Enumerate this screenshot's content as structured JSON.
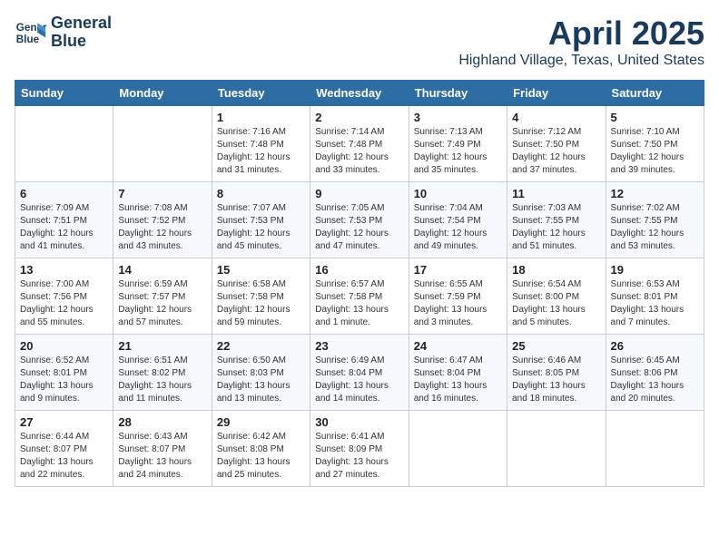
{
  "logo": {
    "line1": "General",
    "line2": "Blue"
  },
  "title": "April 2025",
  "location": "Highland Village, Texas, United States",
  "days_of_week": [
    "Sunday",
    "Monday",
    "Tuesday",
    "Wednesday",
    "Thursday",
    "Friday",
    "Saturday"
  ],
  "weeks": [
    [
      {
        "day": "",
        "info": ""
      },
      {
        "day": "",
        "info": ""
      },
      {
        "day": "1",
        "info": "Sunrise: 7:16 AM\nSunset: 7:48 PM\nDaylight: 12 hours and 31 minutes."
      },
      {
        "day": "2",
        "info": "Sunrise: 7:14 AM\nSunset: 7:48 PM\nDaylight: 12 hours and 33 minutes."
      },
      {
        "day": "3",
        "info": "Sunrise: 7:13 AM\nSunset: 7:49 PM\nDaylight: 12 hours and 35 minutes."
      },
      {
        "day": "4",
        "info": "Sunrise: 7:12 AM\nSunset: 7:50 PM\nDaylight: 12 hours and 37 minutes."
      },
      {
        "day": "5",
        "info": "Sunrise: 7:10 AM\nSunset: 7:50 PM\nDaylight: 12 hours and 39 minutes."
      }
    ],
    [
      {
        "day": "6",
        "info": "Sunrise: 7:09 AM\nSunset: 7:51 PM\nDaylight: 12 hours and 41 minutes."
      },
      {
        "day": "7",
        "info": "Sunrise: 7:08 AM\nSunset: 7:52 PM\nDaylight: 12 hours and 43 minutes."
      },
      {
        "day": "8",
        "info": "Sunrise: 7:07 AM\nSunset: 7:53 PM\nDaylight: 12 hours and 45 minutes."
      },
      {
        "day": "9",
        "info": "Sunrise: 7:05 AM\nSunset: 7:53 PM\nDaylight: 12 hours and 47 minutes."
      },
      {
        "day": "10",
        "info": "Sunrise: 7:04 AM\nSunset: 7:54 PM\nDaylight: 12 hours and 49 minutes."
      },
      {
        "day": "11",
        "info": "Sunrise: 7:03 AM\nSunset: 7:55 PM\nDaylight: 12 hours and 51 minutes."
      },
      {
        "day": "12",
        "info": "Sunrise: 7:02 AM\nSunset: 7:55 PM\nDaylight: 12 hours and 53 minutes."
      }
    ],
    [
      {
        "day": "13",
        "info": "Sunrise: 7:00 AM\nSunset: 7:56 PM\nDaylight: 12 hours and 55 minutes."
      },
      {
        "day": "14",
        "info": "Sunrise: 6:59 AM\nSunset: 7:57 PM\nDaylight: 12 hours and 57 minutes."
      },
      {
        "day": "15",
        "info": "Sunrise: 6:58 AM\nSunset: 7:58 PM\nDaylight: 12 hours and 59 minutes."
      },
      {
        "day": "16",
        "info": "Sunrise: 6:57 AM\nSunset: 7:58 PM\nDaylight: 13 hours and 1 minute."
      },
      {
        "day": "17",
        "info": "Sunrise: 6:55 AM\nSunset: 7:59 PM\nDaylight: 13 hours and 3 minutes."
      },
      {
        "day": "18",
        "info": "Sunrise: 6:54 AM\nSunset: 8:00 PM\nDaylight: 13 hours and 5 minutes."
      },
      {
        "day": "19",
        "info": "Sunrise: 6:53 AM\nSunset: 8:01 PM\nDaylight: 13 hours and 7 minutes."
      }
    ],
    [
      {
        "day": "20",
        "info": "Sunrise: 6:52 AM\nSunset: 8:01 PM\nDaylight: 13 hours and 9 minutes."
      },
      {
        "day": "21",
        "info": "Sunrise: 6:51 AM\nSunset: 8:02 PM\nDaylight: 13 hours and 11 minutes."
      },
      {
        "day": "22",
        "info": "Sunrise: 6:50 AM\nSunset: 8:03 PM\nDaylight: 13 hours and 13 minutes."
      },
      {
        "day": "23",
        "info": "Sunrise: 6:49 AM\nSunset: 8:04 PM\nDaylight: 13 hours and 14 minutes."
      },
      {
        "day": "24",
        "info": "Sunrise: 6:47 AM\nSunset: 8:04 PM\nDaylight: 13 hours and 16 minutes."
      },
      {
        "day": "25",
        "info": "Sunrise: 6:46 AM\nSunset: 8:05 PM\nDaylight: 13 hours and 18 minutes."
      },
      {
        "day": "26",
        "info": "Sunrise: 6:45 AM\nSunset: 8:06 PM\nDaylight: 13 hours and 20 minutes."
      }
    ],
    [
      {
        "day": "27",
        "info": "Sunrise: 6:44 AM\nSunset: 8:07 PM\nDaylight: 13 hours and 22 minutes."
      },
      {
        "day": "28",
        "info": "Sunrise: 6:43 AM\nSunset: 8:07 PM\nDaylight: 13 hours and 24 minutes."
      },
      {
        "day": "29",
        "info": "Sunrise: 6:42 AM\nSunset: 8:08 PM\nDaylight: 13 hours and 25 minutes."
      },
      {
        "day": "30",
        "info": "Sunrise: 6:41 AM\nSunset: 8:09 PM\nDaylight: 13 hours and 27 minutes."
      },
      {
        "day": "",
        "info": ""
      },
      {
        "day": "",
        "info": ""
      },
      {
        "day": "",
        "info": ""
      }
    ]
  ]
}
